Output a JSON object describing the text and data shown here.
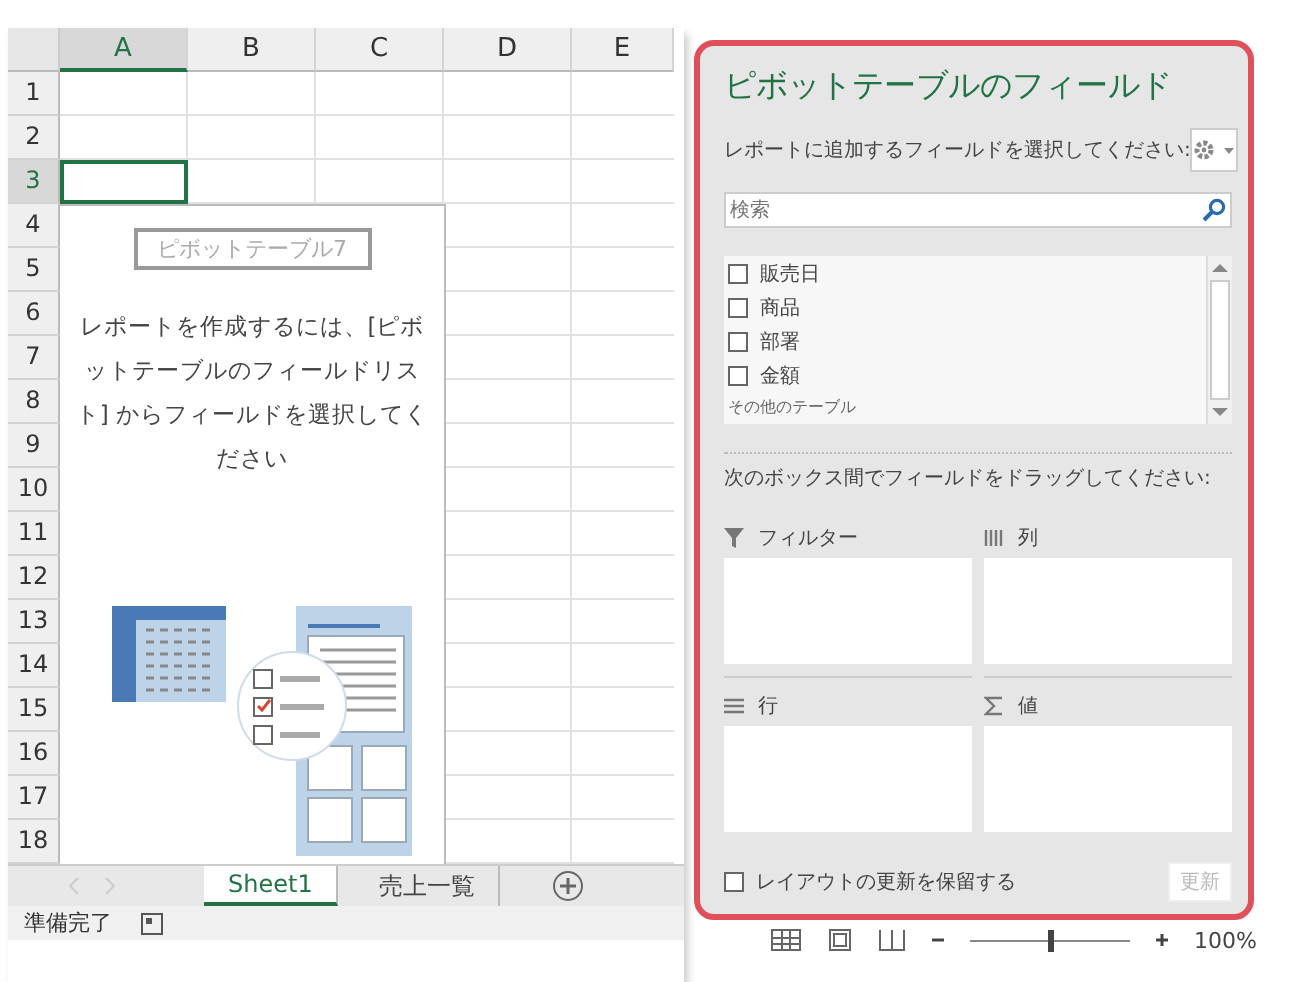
{
  "sheet": {
    "columns": [
      {
        "label": "A",
        "selected": true
      },
      {
        "label": "B",
        "selected": false
      },
      {
        "label": "C",
        "selected": false
      },
      {
        "label": "D",
        "selected": false
      },
      {
        "label": "E",
        "selected": false
      }
    ],
    "rows": [
      {
        "label": "1",
        "selected": false
      },
      {
        "label": "2",
        "selected": false
      },
      {
        "label": "3",
        "selected": true
      },
      {
        "label": "4",
        "selected": false
      },
      {
        "label": "5",
        "selected": false
      },
      {
        "label": "6",
        "selected": false
      },
      {
        "label": "7",
        "selected": false
      },
      {
        "label": "8",
        "selected": false
      },
      {
        "label": "9",
        "selected": false
      },
      {
        "label": "10",
        "selected": false
      },
      {
        "label": "11",
        "selected": false
      },
      {
        "label": "12",
        "selected": false
      },
      {
        "label": "13",
        "selected": false
      },
      {
        "label": "14",
        "selected": false
      },
      {
        "label": "15",
        "selected": false
      },
      {
        "label": "16",
        "selected": false
      },
      {
        "label": "17",
        "selected": false
      },
      {
        "label": "18",
        "selected": false
      }
    ],
    "pivot_placeholder": {
      "name": "ピボットテーブル7",
      "message": "レポートを作成するには、[ピボットテーブルのフィールドリスト] からフィールドを選択してください"
    },
    "tabs": [
      {
        "label": "Sheet1",
        "selected": true
      },
      {
        "label": "売上一覧",
        "selected": false
      }
    ]
  },
  "status_bar": {
    "text": "準備完了",
    "zoom": "100%",
    "zoom_slider": {
      "level": 0.5
    }
  },
  "field_panel": {
    "title": "ピボットテーブルのフィールド",
    "subtitle": "レポートに追加するフィールドを選択してください:",
    "search": {
      "placeholder": "検索"
    },
    "fields": [
      {
        "label": "販売日",
        "checked": false
      },
      {
        "label": "商品",
        "checked": false
      },
      {
        "label": "部署",
        "checked": false
      },
      {
        "label": "金額",
        "checked": false
      }
    ],
    "more_tables": "その他のテーブル",
    "drag_hint": "次のボックス間でフィールドをドラッグしてください:",
    "areas": [
      {
        "kind": "filter",
        "label": "フィルター"
      },
      {
        "kind": "columns",
        "label": "列"
      },
      {
        "kind": "rows",
        "label": "行"
      },
      {
        "kind": "values",
        "label": "値"
      }
    ],
    "defer_update": {
      "label": "レイアウトの更新を保留する",
      "checked": false
    },
    "update_button": {
      "label": "更新",
      "disabled": true
    }
  }
}
